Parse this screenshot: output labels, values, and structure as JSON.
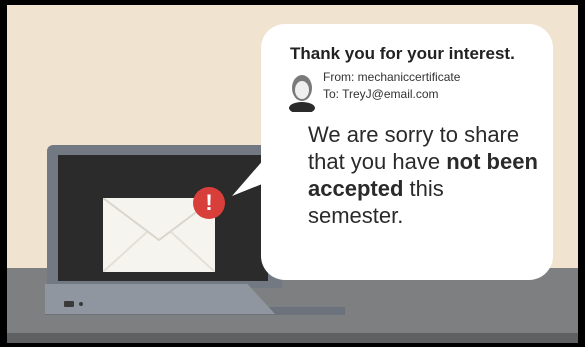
{
  "email": {
    "subject": "Thank you for your interest.",
    "from": "From: mechaniccertificate",
    "to": "To: TreyJ@email.com",
    "message": {
      "part1": "We are sorry to share that you have ",
      "bold1": "not",
      "part2": " ",
      "bold2": "been accepted",
      "part3": " this semester."
    }
  },
  "laptop": {
    "badge_text": "!",
    "icons": [
      "envelope-icon",
      "alert-badge-icon",
      "person-avatar-icon"
    ]
  },
  "colors": {
    "background": "#f0e3d0",
    "desk": "#7e7f81",
    "laptop_frame": "#727983",
    "screen": "#2b2b2b",
    "envelope": "#f5f4ee",
    "alert": "#d93f3a",
    "bubble": "#ffffff"
  }
}
